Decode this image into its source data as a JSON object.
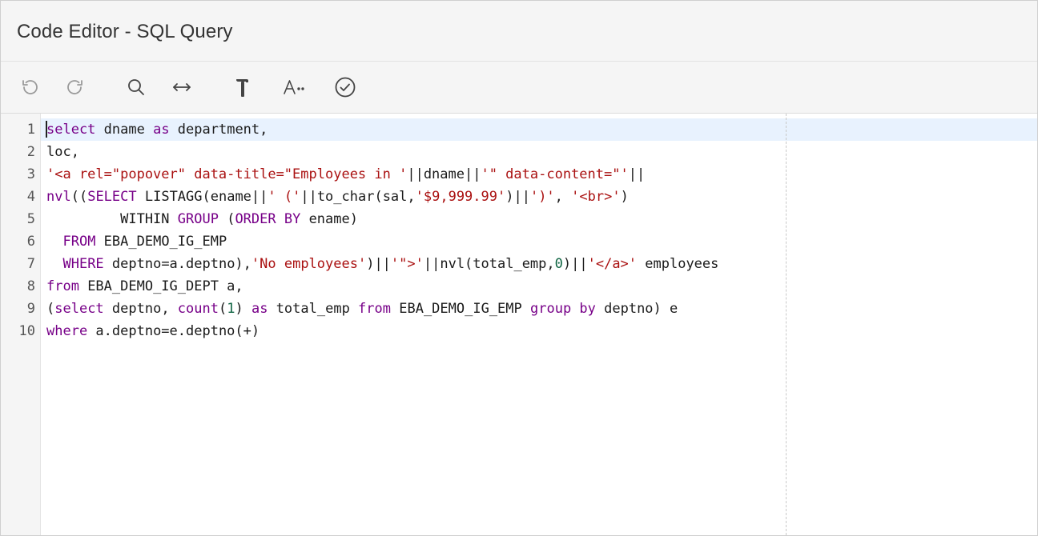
{
  "window": {
    "title": "Code Editor - SQL Query"
  },
  "toolbar": {
    "buttons": [
      {
        "name": "undo",
        "icon": "undo-icon",
        "enabled": false
      },
      {
        "name": "redo",
        "icon": "redo-icon",
        "enabled": false
      },
      {
        "name": "find",
        "icon": "search-icon",
        "enabled": true
      },
      {
        "name": "replace",
        "icon": "swap-arrows-icon",
        "enabled": true
      },
      {
        "name": "query-builder",
        "icon": "hammer-icon",
        "enabled": true
      },
      {
        "name": "settings",
        "icon": "font-settings-icon",
        "enabled": true
      },
      {
        "name": "validate",
        "icon": "check-circle-icon",
        "enabled": true
      }
    ]
  },
  "colors": {
    "keyword": "#770088",
    "string": "#aa1111",
    "number": "#116644",
    "active_line": "#e8f2fe"
  },
  "editor": {
    "active_line": 1,
    "lines": [
      {
        "number": "1",
        "tokens": [
          [
            "kw",
            "select"
          ],
          [
            "plain",
            " dname "
          ],
          [
            "kw",
            "as"
          ],
          [
            "plain",
            " department,"
          ]
        ]
      },
      {
        "number": "2",
        "tokens": [
          [
            "plain",
            "loc,"
          ]
        ]
      },
      {
        "number": "3",
        "tokens": [
          [
            "str",
            "'<a rel=\"popover\" data-title=\"Employees in '"
          ],
          [
            "plain",
            "||dname||"
          ],
          [
            "str",
            "'\" data-content=\"'"
          ],
          [
            "plain",
            "||"
          ]
        ]
      },
      {
        "number": "4",
        "tokens": [
          [
            "kw",
            "nvl"
          ],
          [
            "plain",
            "(("
          ],
          [
            "kw",
            "SELECT"
          ],
          [
            "plain",
            " LISTAGG(ename||"
          ],
          [
            "str",
            "' ('"
          ],
          [
            "plain",
            "||to_char(sal,"
          ],
          [
            "str",
            "'$9,999.99'"
          ],
          [
            "plain",
            ")||"
          ],
          [
            "str",
            "')'"
          ],
          [
            "plain",
            ", "
          ],
          [
            "str",
            "'<br>'"
          ],
          [
            "plain",
            ")"
          ]
        ]
      },
      {
        "number": "5",
        "tokens": [
          [
            "plain",
            "         WITHIN "
          ],
          [
            "kw",
            "GROUP"
          ],
          [
            "plain",
            " ("
          ],
          [
            "kw",
            "ORDER BY"
          ],
          [
            "plain",
            " ename)"
          ]
        ]
      },
      {
        "number": "6",
        "tokens": [
          [
            "plain",
            "  "
          ],
          [
            "kw",
            "FROM"
          ],
          [
            "plain",
            " EBA_DEMO_IG_EMP"
          ]
        ]
      },
      {
        "number": "7",
        "tokens": [
          [
            "plain",
            "  "
          ],
          [
            "kw",
            "WHERE"
          ],
          [
            "plain",
            " deptno=a.deptno),"
          ],
          [
            "str",
            "'No employees'"
          ],
          [
            "plain",
            ")||"
          ],
          [
            "str",
            "'\">'"
          ],
          [
            "plain",
            "||nvl(total_emp,"
          ],
          [
            "num",
            "0"
          ],
          [
            "plain",
            ")||"
          ],
          [
            "str",
            "'</a>'"
          ],
          [
            "plain",
            " employees"
          ]
        ]
      },
      {
        "number": "8",
        "tokens": [
          [
            "kw",
            "from"
          ],
          [
            "plain",
            " EBA_DEMO_IG_DEPT a,"
          ]
        ]
      },
      {
        "number": "9",
        "tokens": [
          [
            "plain",
            "("
          ],
          [
            "kw",
            "select"
          ],
          [
            "plain",
            " deptno, "
          ],
          [
            "kw",
            "count"
          ],
          [
            "plain",
            "("
          ],
          [
            "num",
            "1"
          ],
          [
            "plain",
            ") "
          ],
          [
            "kw",
            "as"
          ],
          [
            "plain",
            " total_emp "
          ],
          [
            "kw",
            "from"
          ],
          [
            "plain",
            " EBA_DEMO_IG_EMP "
          ],
          [
            "kw",
            "group by"
          ],
          [
            "plain",
            " deptno) e"
          ]
        ]
      },
      {
        "number": "10",
        "tokens": [
          [
            "kw",
            "where"
          ],
          [
            "plain",
            " a.deptno=e.deptno(+)"
          ]
        ]
      }
    ]
  }
}
